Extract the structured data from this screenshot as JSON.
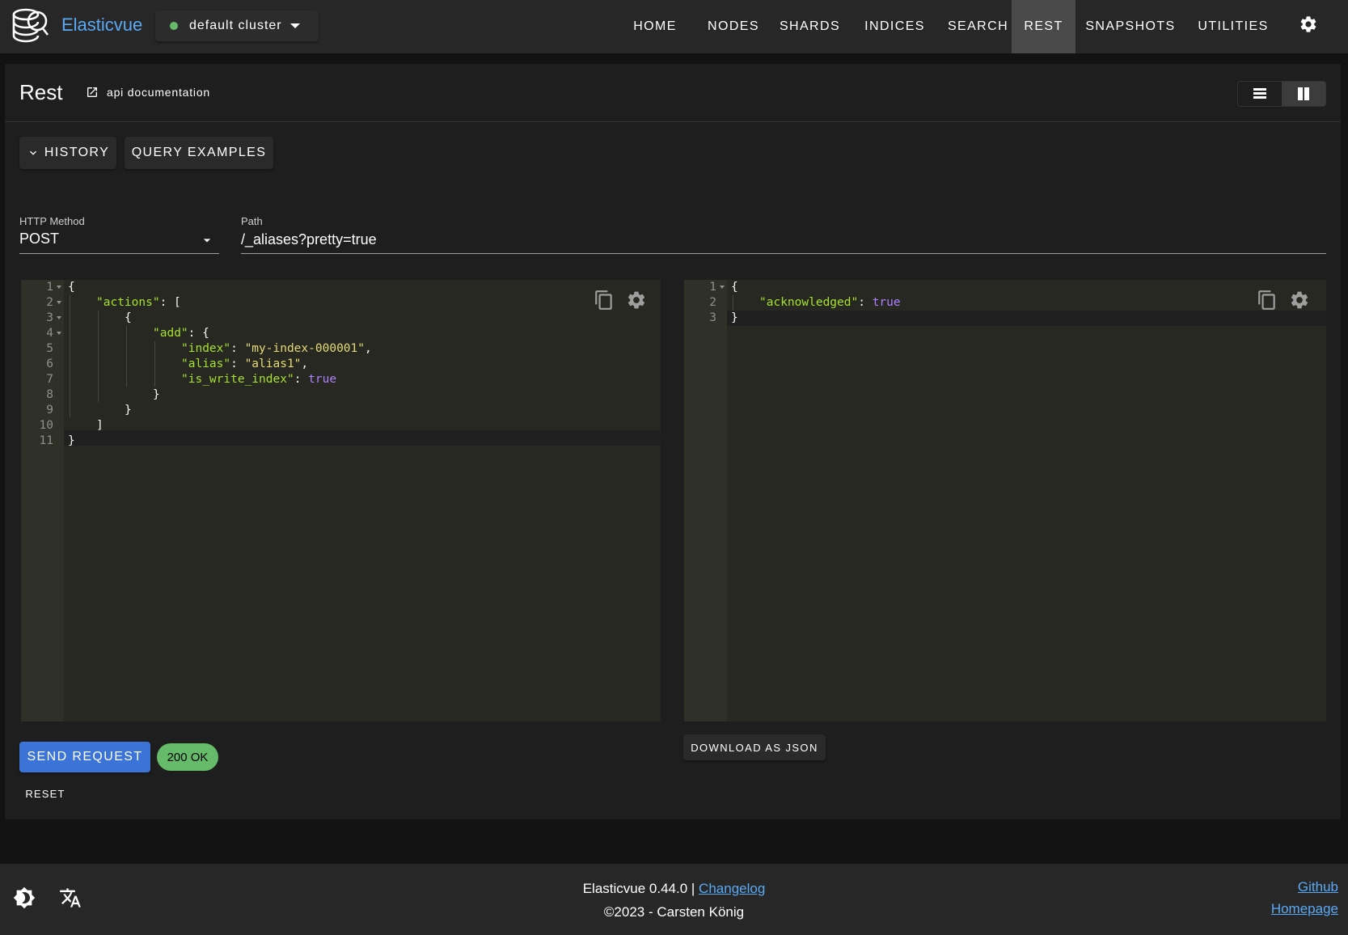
{
  "appbar": {
    "brand": "Elasticvue",
    "cluster": {
      "label": "default cluster",
      "status_color": "#66bb6a"
    },
    "nav": [
      "HOME",
      "NODES",
      "SHARDS",
      "INDICES",
      "SEARCH",
      "REST",
      "SNAPSHOTS",
      "UTILITIES"
    ],
    "active_nav": "REST"
  },
  "page": {
    "title": "Rest",
    "doc_link": "api documentation",
    "history_button": "HISTORY",
    "examples_button": "QUERY EXAMPLES",
    "method": {
      "label": "HTTP Method",
      "value": "POST"
    },
    "path": {
      "label": "Path",
      "value": "/_aliases?pretty=true"
    }
  },
  "request_editor": {
    "lines": [
      {
        "n": "1"
      },
      {
        "n": "2"
      },
      {
        "n": "3"
      },
      {
        "n": "4"
      },
      {
        "n": "5"
      },
      {
        "n": "6"
      },
      {
        "n": "7"
      },
      {
        "n": "8"
      },
      {
        "n": "9"
      },
      {
        "n": "10"
      },
      {
        "n": "11"
      }
    ],
    "tokens": {
      "l1": "{",
      "l2_key": "\"actions\"",
      "l2_rest": ": [",
      "l3": "{",
      "l4_key": "\"add\"",
      "l4_rest": ": {",
      "l5_key": "\"index\"",
      "l5_sep": ": ",
      "l5_val": "\"my-index-000001\"",
      "l5_end": ",",
      "l6_key": "\"alias\"",
      "l6_sep": ": ",
      "l6_val": "\"alias1\"",
      "l6_end": ",",
      "l7_key": "\"is_write_index\"",
      "l7_sep": ": ",
      "l7_val": "true",
      "l8": "}",
      "l9": "}",
      "l10": "]",
      "l11": "}"
    }
  },
  "response_editor": {
    "lines": [
      {
        "n": "1"
      },
      {
        "n": "2"
      },
      {
        "n": "3"
      }
    ],
    "tokens": {
      "l1": "{",
      "l2_key": "\"acknowledged\"",
      "l2_sep": ": ",
      "l2_val": "true",
      "l3": "}"
    }
  },
  "actions": {
    "send": "SEND REQUEST",
    "status": "200 OK",
    "reset": "RESET",
    "download": "DOWNLOAD AS JSON"
  },
  "footer": {
    "version": "Elasticvue 0.44.0 | ",
    "changelog": "Changelog",
    "copyright": "©2023 - Carsten König",
    "github": "Github",
    "homepage": "Homepage"
  },
  "colors": {
    "accent": "#5aa9f5",
    "primary_button": "#3b73d6",
    "success": "#66bb6a",
    "editor_bg": "#272822"
  }
}
